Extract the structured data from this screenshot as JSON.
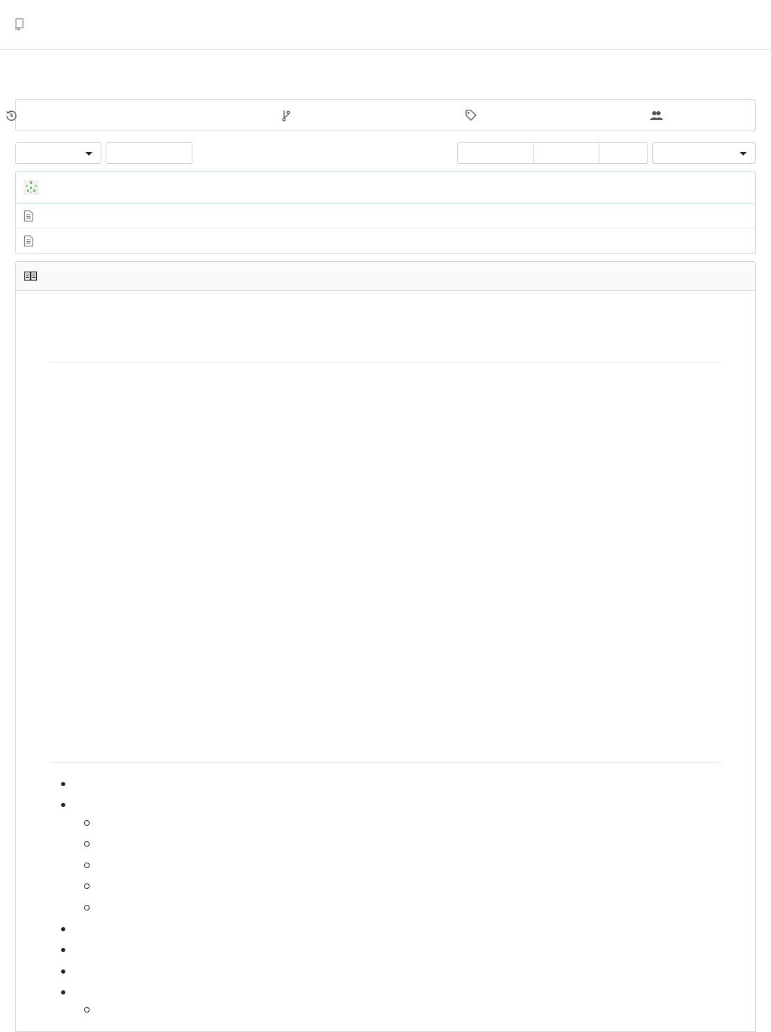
{
  "header": {
    "repo_icon": "repo-icon",
    "title": ""
  },
  "stats": [
    {
      "icon": "history-icon",
      "label": ""
    },
    {
      "icon": "branch-icon",
      "label": ""
    },
    {
      "icon": "tag-icon",
      "label": ""
    },
    {
      "icon": "contributors-icon",
      "label": ""
    }
  ],
  "toolbar": {
    "branch_label": "",
    "new_file_label": "",
    "clone_protocol": "",
    "clone_url": "",
    "copy_label": "",
    "download_label": ""
  },
  "latest_commit": {
    "author_avatar": "identicon-avatar",
    "message": "",
    "sha": "",
    "time": ""
  },
  "files": [
    {
      "icon": "file-icon",
      "name": "",
      "commit": "",
      "time": ""
    },
    {
      "icon": "file-icon",
      "name": "",
      "commit": "",
      "time": ""
    }
  ],
  "readme": {
    "icon": "book-icon",
    "filename": "",
    "list": [
      {
        "text": "",
        "level": 1
      },
      {
        "text": "",
        "level": 1
      },
      {
        "text": "",
        "level": 2
      },
      {
        "text": "",
        "level": 2
      },
      {
        "text": "",
        "level": 2
      },
      {
        "text": "",
        "level": 2
      },
      {
        "text": "",
        "level": 2
      },
      {
        "text": "",
        "level": 1
      },
      {
        "text": "",
        "level": 1
      },
      {
        "text": "",
        "level": 1
      },
      {
        "text": "",
        "level": 1
      },
      {
        "text": "",
        "level": 2
      }
    ]
  },
  "colors": {
    "border": "#d4d4d5",
    "avatar_green": "#6cc644",
    "icon_gray": "#555555"
  }
}
